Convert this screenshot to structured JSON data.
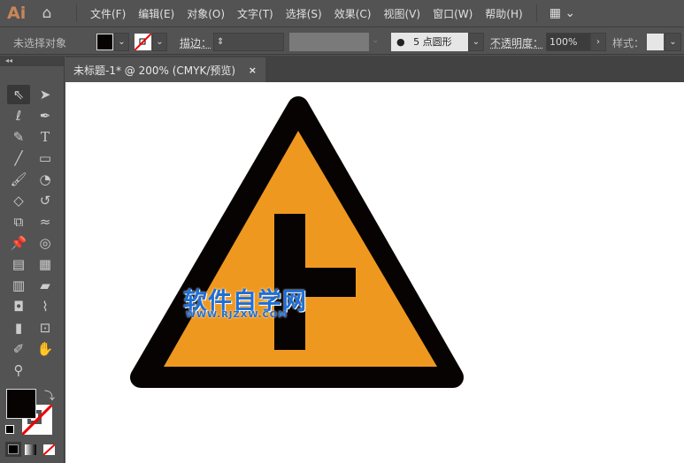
{
  "app": {
    "logo": "Ai"
  },
  "menu": [
    "文件(F)",
    "编辑(E)",
    "对象(O)",
    "文字(T)",
    "选择(S)",
    "效果(C)",
    "视图(V)",
    "窗口(W)",
    "帮助(H)"
  ],
  "control": {
    "selection": "未选择对象",
    "stroke_label": "描边：",
    "brush_value": "5 点圆形",
    "opacity_label": "不透明度：",
    "opacity_value": "100%",
    "style_label": "样式："
  },
  "document_tab": {
    "title": "未标题-1* @ 200% (CMYK/预览)",
    "close": "×"
  },
  "watermark": {
    "title": "软件自学网",
    "url": "WWW.RJZXW.COM"
  },
  "colors": {
    "fill": "#070303",
    "sign_orange": "#ef981f",
    "sign_black": "#070303"
  }
}
